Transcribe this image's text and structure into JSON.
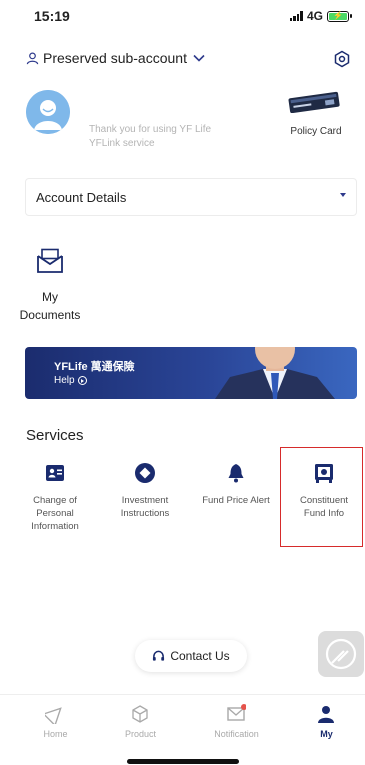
{
  "status": {
    "time": "15:19",
    "network": "4G"
  },
  "header": {
    "account_label": "Preserved sub-account"
  },
  "profile": {
    "thanks_line1": "Thank you for using YF Life",
    "thanks_line2": "YFLink service",
    "policy_card_label": "Policy Card"
  },
  "account": {
    "details_label": "Account Details"
  },
  "documents": {
    "label_line1": "My",
    "label_line2": "Documents"
  },
  "banner": {
    "brand": "YFLife 萬通保險",
    "help": "Help"
  },
  "services": {
    "title": "Services",
    "items": [
      {
        "line1": "Change of",
        "line2": "Personal",
        "line3": "Information",
        "icon": "profile-card-icon"
      },
      {
        "line1": "Investment",
        "line2": "Instructions",
        "line3": "",
        "icon": "diamond-icon"
      },
      {
        "line1": "Fund Price Alert",
        "line2": "",
        "line3": "",
        "icon": "bell-icon"
      },
      {
        "line1": "Constituent",
        "line2": "Fund Info",
        "line3": "",
        "icon": "safe-icon"
      }
    ]
  },
  "contact": {
    "label": "Contact Us"
  },
  "nav": {
    "items": [
      {
        "label": "Home",
        "icon": "home-icon"
      },
      {
        "label": "Product",
        "icon": "cube-icon"
      },
      {
        "label": "Notification",
        "icon": "mail-icon"
      },
      {
        "label": "My",
        "icon": "person-icon"
      }
    ],
    "active": "My"
  },
  "colors": {
    "brand_navy": "#1a2b6e",
    "highlight_red": "#d62b2b",
    "notification_dot": "#e5534b"
  }
}
